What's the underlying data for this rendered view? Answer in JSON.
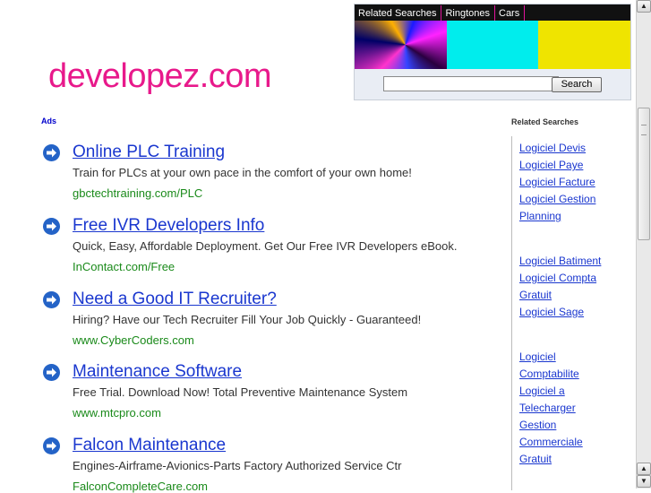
{
  "site": {
    "logo_text": "developez.com"
  },
  "topbox": {
    "nav": [
      "Related Searches",
      "Ringtones",
      "Cars"
    ],
    "search_button": "Search",
    "search_value": ""
  },
  "ads": {
    "label": "Ads",
    "items": [
      {
        "title": "Online PLC Training",
        "desc": "Train for PLCs at your own pace in the comfort of your own home!",
        "url": "gbctechtraining.com/PLC"
      },
      {
        "title": "Free IVR Developers Info",
        "desc": "Quick, Easy, Affordable Deployment. Get Our Free IVR Developers eBook.",
        "url": "InContact.com/Free"
      },
      {
        "title": "Need a Good IT Recruiter?",
        "desc": "Hiring? Have our Tech Recruiter Fill Your Job Quickly - Guaranteed!",
        "url": "www.CyberCoders.com"
      },
      {
        "title": "Maintenance Software",
        "desc": "Free Trial. Download Now! Total Preventive Maintenance System",
        "url": "www.mtcpro.com"
      },
      {
        "title": "Falcon Maintenance",
        "desc": "Engines-Airframe-Avionics-Parts Factory Authorized Service Ctr",
        "url": "FalconCompleteCare.com"
      }
    ]
  },
  "related": {
    "title": "Related Searches",
    "groups": [
      [
        "Logiciel Devis",
        "Logiciel Paye",
        "Logiciel Facture",
        "Logiciel Gestion",
        "Planning"
      ],
      [
        "Logiciel Batiment",
        "Logiciel Compta",
        "Gratuit",
        "Logiciel Sage"
      ],
      [
        "Logiciel",
        "Comptabilite",
        "Logiciel a",
        "Telecharger",
        "Gestion",
        "Commerciale",
        "Gratuit"
      ]
    ]
  },
  "colors": {
    "logo": "#e8198b",
    "link": "#1a37cf",
    "url": "#1a8a1a",
    "arrow": "#2463c7"
  },
  "icons": {
    "ad_arrow": "arrow-right-circle-icon",
    "scroll_up": "arrow-up-icon",
    "scroll_down": "arrow-down-icon"
  }
}
